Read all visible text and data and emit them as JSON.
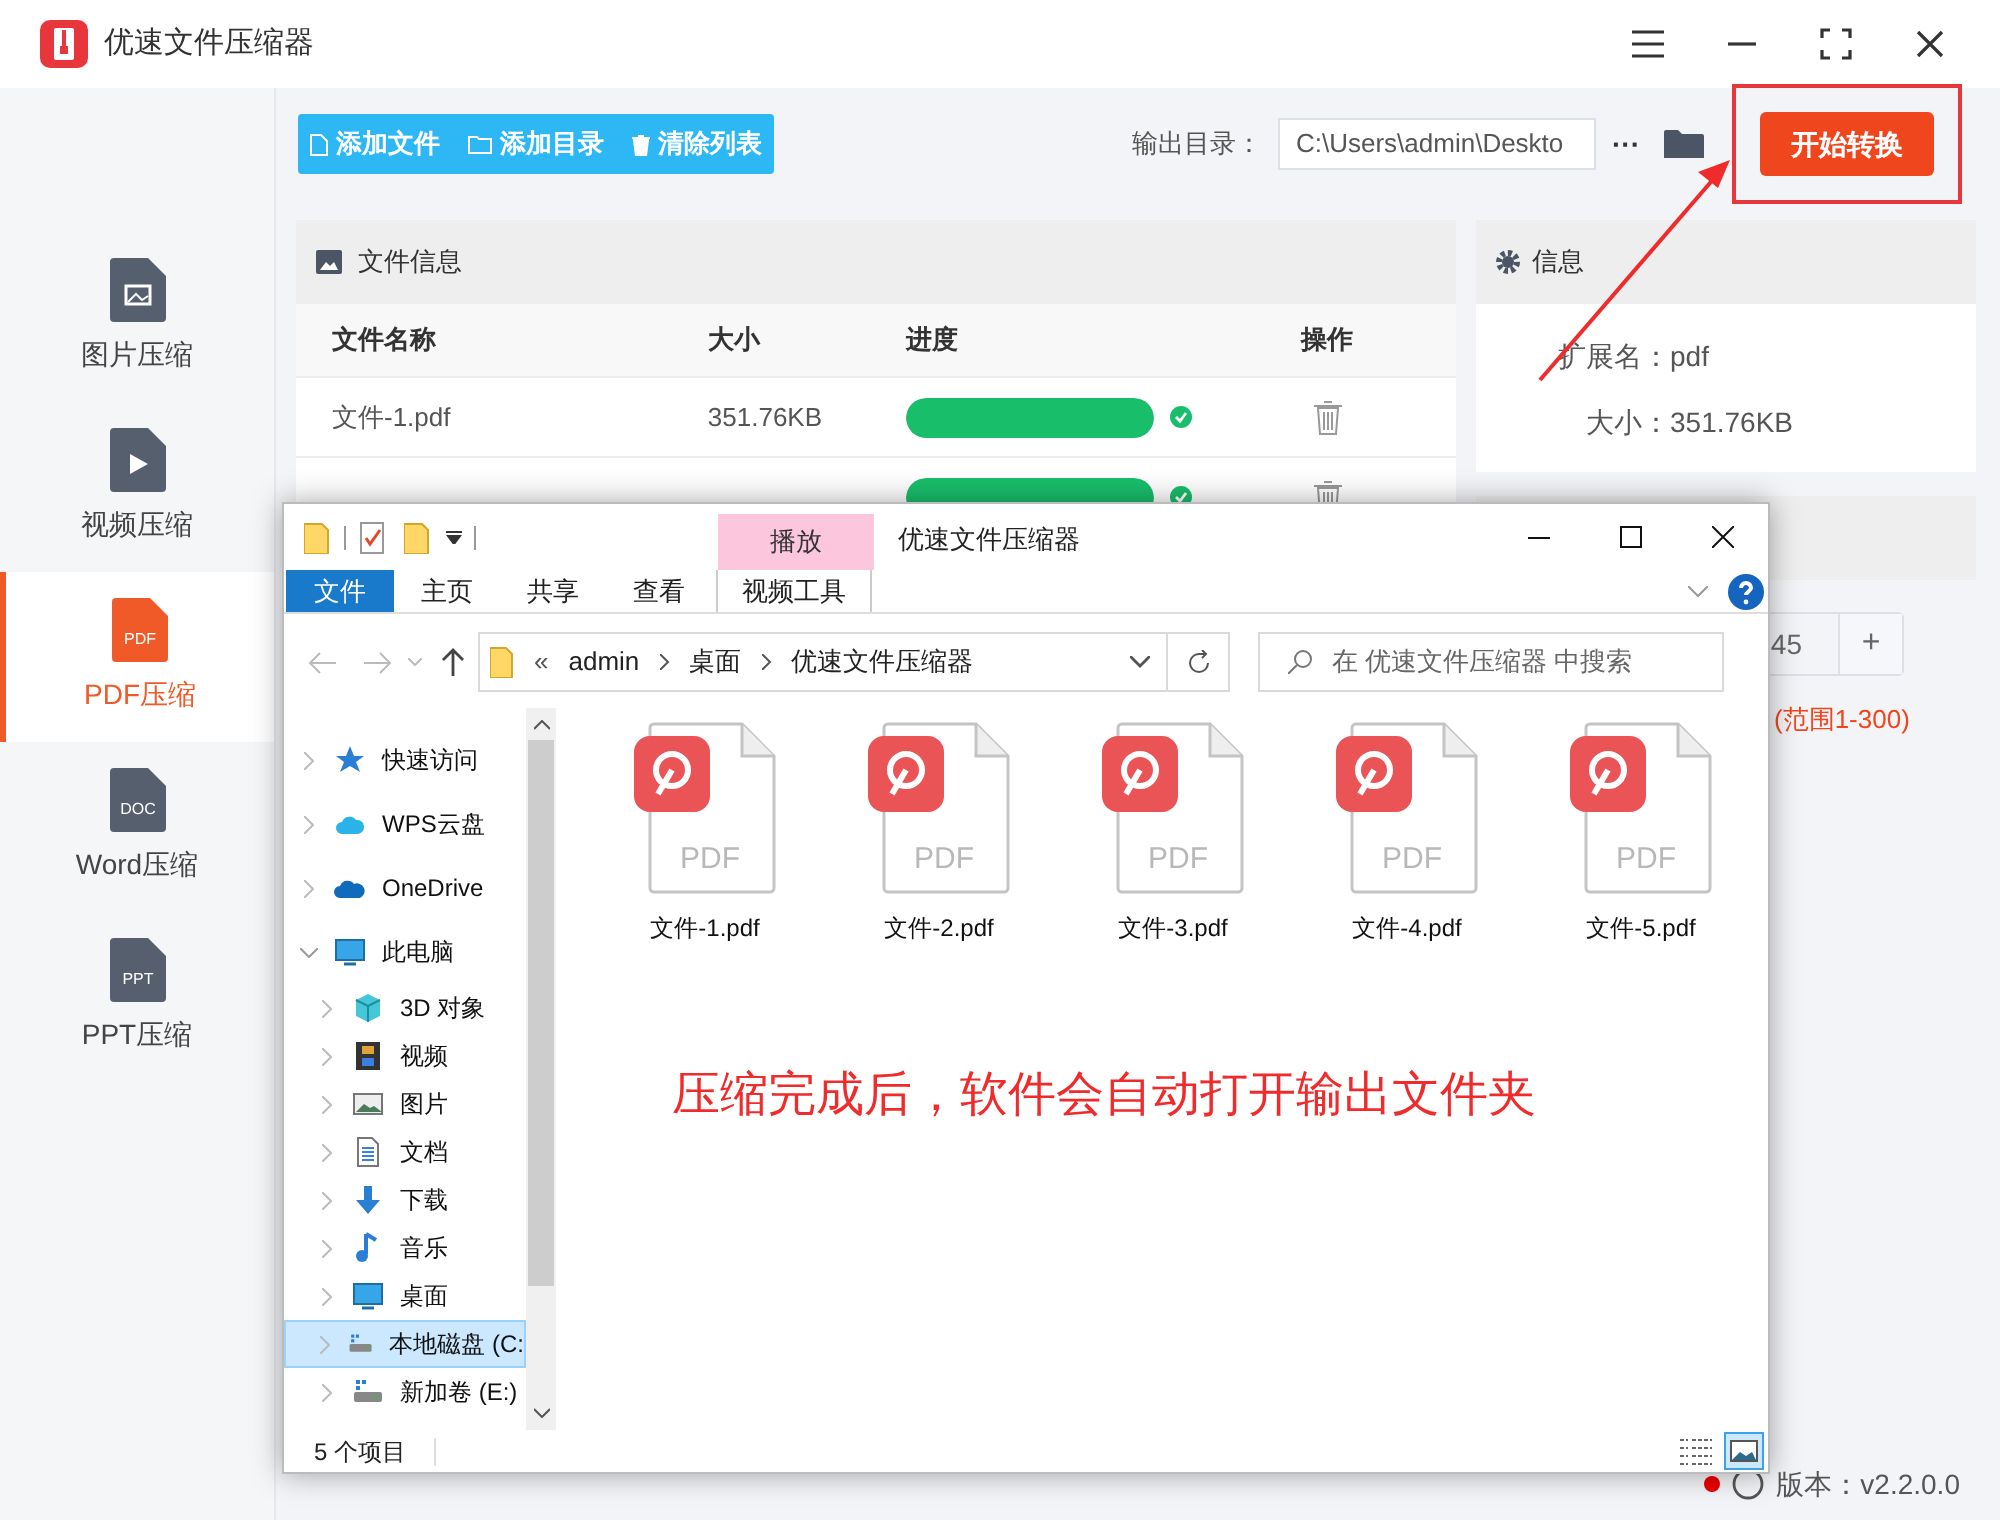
{
  "app": {
    "title": "优速文件压缩器",
    "sidebar": [
      {
        "label": "图片压缩",
        "kind": "image",
        "selected": false
      },
      {
        "label": "视频压缩",
        "kind": "video",
        "selected": false
      },
      {
        "label": "PDF压缩",
        "kind": "pdf",
        "badge": "PDF",
        "selected": true
      },
      {
        "label": "Word压缩",
        "kind": "doc",
        "badge": "DOC",
        "selected": false
      },
      {
        "label": "PPT压缩",
        "kind": "ppt",
        "badge": "PPT",
        "selected": false
      }
    ],
    "toolbar": [
      {
        "label": "添加文件",
        "kind": "file"
      },
      {
        "label": "添加目录",
        "kind": "folder"
      },
      {
        "label": "清除列表",
        "kind": "trash"
      }
    ],
    "output_label": "输出目录：",
    "output_value": "C:\\Users\\admin\\Deskto",
    "more": "···",
    "start_button": "开始转换",
    "file_panel": {
      "title": "文件信息",
      "columns": [
        "文件名称",
        "大小",
        "进度",
        "操作"
      ],
      "rows": [
        {
          "name": "文件-1.pdf",
          "size": "351.76KB",
          "level": 1
        },
        {
          "level": 1
        }
      ]
    },
    "info_panel": {
      "title": "信息",
      "fields": [
        {
          "label": "扩展名：",
          "value": "pdf"
        },
        {
          "label": "大小：",
          "value": "351.76KB"
        }
      ]
    },
    "settings": {
      "value": "45",
      "plus": "+",
      "hint": "(范围1-300)"
    },
    "version": "版本：v2.2.0.0"
  },
  "explorer": {
    "title": "优速文件压缩器",
    "context_tab": "播放",
    "ribbon_tabs": [
      {
        "label": "文件",
        "kind": "file",
        "selected": true
      },
      {
        "label": "主页",
        "kind": "normal",
        "selected": false
      },
      {
        "label": "共享",
        "kind": "normal",
        "selected": false
      },
      {
        "label": "查看",
        "kind": "normal",
        "selected": false
      },
      {
        "label": "视频工具",
        "kind": "contextual",
        "selected": false
      }
    ],
    "breadcrumb_prefix": "«",
    "breadcrumb": [
      "admin",
      "桌面",
      "优速文件压缩器"
    ],
    "search_placeholder": "在 优速文件压缩器 中搜索",
    "nav": [
      {
        "label": "快速访问",
        "kind": "star",
        "expanded": false
      },
      {
        "label": "WPS云盘",
        "kind": "cloud",
        "expanded": false
      },
      {
        "label": "OneDrive",
        "kind": "onedrive",
        "expanded": false
      },
      {
        "label": "此电脑",
        "kind": "pc",
        "expanded": true,
        "children": [
          {
            "label": "3D 对象",
            "kind": "cube",
            "selected": false
          },
          {
            "label": "视频",
            "kind": "film",
            "selected": false
          },
          {
            "label": "图片",
            "kind": "image",
            "selected": false
          },
          {
            "label": "文档",
            "kind": "doc",
            "selected": false
          },
          {
            "label": "下载",
            "kind": "download",
            "selected": false
          },
          {
            "label": "音乐",
            "kind": "music",
            "selected": false
          },
          {
            "label": "桌面",
            "kind": "desktop",
            "selected": false
          },
          {
            "label": "本地磁盘 (C:",
            "kind": "drive",
            "selected": true
          },
          {
            "label": "新加卷 (E:)",
            "kind": "drive",
            "selected": false
          }
        ]
      }
    ],
    "files": [
      {
        "name": "文件-1.pdf",
        "badge": "PDF"
      },
      {
        "name": "文件-2.pdf",
        "badge": "PDF"
      },
      {
        "name": "文件-3.pdf",
        "badge": "PDF"
      },
      {
        "name": "文件-4.pdf",
        "badge": "PDF"
      },
      {
        "name": "文件-5.pdf",
        "badge": "PDF"
      }
    ],
    "status": "5 个项目"
  },
  "annotation": "压缩完成后，软件会自动打开输出文件夹"
}
